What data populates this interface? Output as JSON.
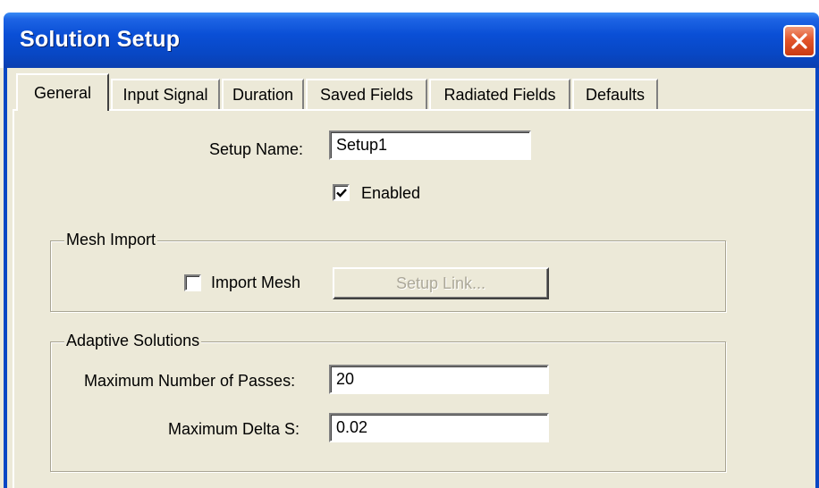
{
  "window": {
    "title": "Solution Setup"
  },
  "tabs": [
    {
      "label": "General",
      "active": true
    },
    {
      "label": "Input Signal",
      "active": false
    },
    {
      "label": "Duration",
      "active": false
    },
    {
      "label": "Saved Fields",
      "active": false
    },
    {
      "label": "Radiated Fields",
      "active": false
    },
    {
      "label": "Defaults",
      "active": false
    }
  ],
  "general": {
    "setup_name_label": "Setup Name:",
    "setup_name_value": "Setup1",
    "enabled_label": "Enabled",
    "enabled_checked": true
  },
  "mesh_import": {
    "group_label": "Mesh Import",
    "import_mesh_label": "Import Mesh",
    "import_mesh_checked": false,
    "setup_link_label": "Setup Link...",
    "setup_link_enabled": false
  },
  "adaptive_solutions": {
    "group_label": "Adaptive Solutions",
    "max_passes_label": "Maximum Number of Passes:",
    "max_passes_value": "20",
    "max_delta_s_label": "Maximum Delta S:",
    "max_delta_s_value": "0.02"
  },
  "icons": {
    "close": "close-icon",
    "checkmark": "checkmark-icon"
  },
  "colors": {
    "title_bar": "#0847c4",
    "close_button": "#e2552b",
    "dialog_bg": "#ece9d8",
    "disabled_text": "#aca899"
  }
}
